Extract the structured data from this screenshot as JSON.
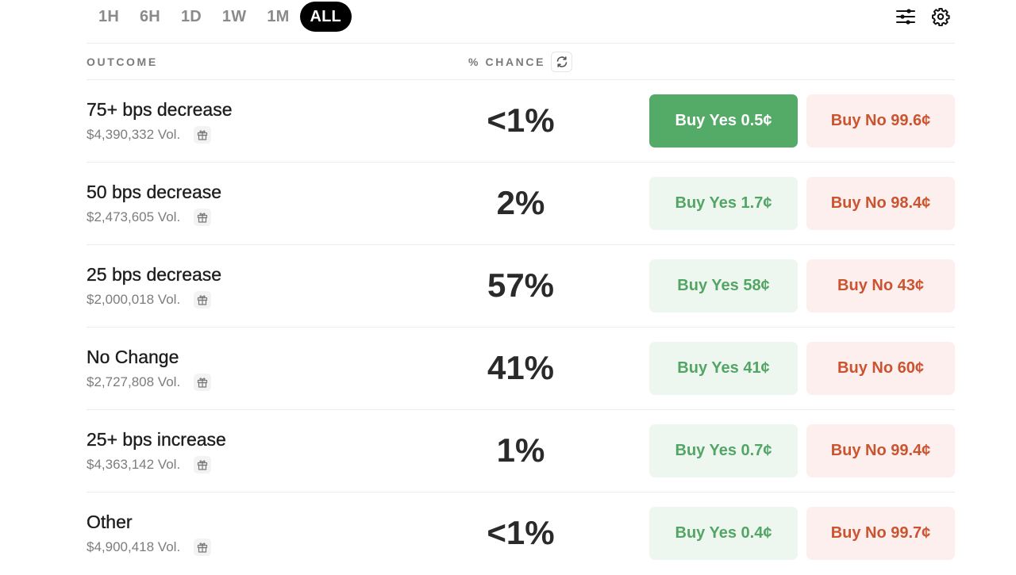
{
  "time_ranges": [
    {
      "label": "1H",
      "active": false
    },
    {
      "label": "6H",
      "active": false
    },
    {
      "label": "1D",
      "active": false
    },
    {
      "label": "1W",
      "active": false
    },
    {
      "label": "1M",
      "active": false
    },
    {
      "label": "ALL",
      "active": true
    }
  ],
  "toolbar": {
    "filter_icon": "sliders-icon",
    "settings_icon": "gear-icon"
  },
  "table_header": {
    "outcome": "OUTCOME",
    "chance": "% CHANCE",
    "refresh_icon": "refresh-icon"
  },
  "colors": {
    "yes_text": "#53a565",
    "yes_bg": "#eef7ef",
    "yes_active_bg": "#54ab68",
    "no_text": "#cb5430",
    "no_bg": "#fcefee",
    "active_range_bg": "#000000"
  },
  "outcomes": [
    {
      "name": "75+ bps decrease",
      "volume": "$4,390,332 Vol.",
      "chance": "<1%",
      "buy_yes": "Buy Yes 0.5¢",
      "buy_no": "Buy No 99.6¢",
      "yes_selected": true
    },
    {
      "name": "50 bps decrease",
      "volume": "$2,473,605 Vol.",
      "chance": "2%",
      "buy_yes": "Buy Yes 1.7¢",
      "buy_no": "Buy No 98.4¢",
      "yes_selected": false
    },
    {
      "name": "25 bps decrease",
      "volume": "$2,000,018 Vol.",
      "chance": "57%",
      "buy_yes": "Buy Yes 58¢",
      "buy_no": "Buy No 43¢",
      "yes_selected": false
    },
    {
      "name": "No Change",
      "volume": "$2,727,808 Vol.",
      "chance": "41%",
      "buy_yes": "Buy Yes 41¢",
      "buy_no": "Buy No 60¢",
      "yes_selected": false
    },
    {
      "name": "25+ bps increase",
      "volume": "$4,363,142 Vol.",
      "chance": "1%",
      "buy_yes": "Buy Yes 0.7¢",
      "buy_no": "Buy No 99.4¢",
      "yes_selected": false
    },
    {
      "name": "Other",
      "volume": "$4,900,418 Vol.",
      "chance": "<1%",
      "buy_yes": "Buy Yes 0.4¢",
      "buy_no": "Buy No 99.7¢",
      "yes_selected": false
    }
  ]
}
